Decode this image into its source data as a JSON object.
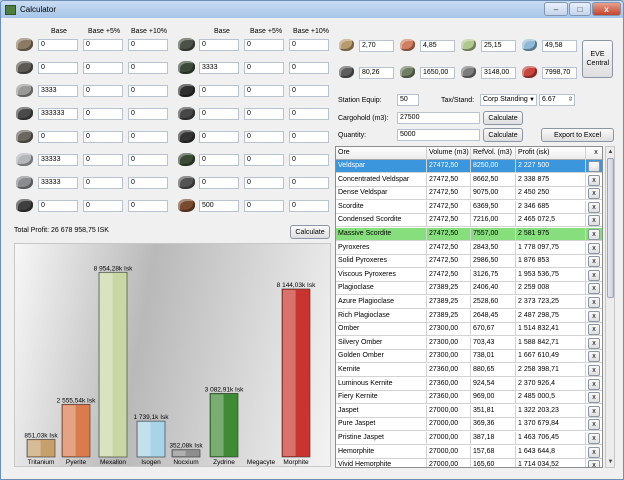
{
  "window": {
    "title": "Calculator",
    "minimize": "–",
    "maximize": "□",
    "close": "x"
  },
  "left_headers": {
    "col1": "Base",
    "col2": "Base +5%",
    "col3": "Base +10%"
  },
  "right_headers": {
    "col1": "Base",
    "col2": "Base +5%",
    "col3": "Base +10%"
  },
  "left_rows": [
    {
      "ore": "veldspar-ore-icon",
      "color": "#8c7a64",
      "v": [
        "0",
        "0",
        "0"
      ]
    },
    {
      "ore": "scordite-ore-icon",
      "color": "#5d5a56",
      "v": [
        "0",
        "0",
        "0"
      ]
    },
    {
      "ore": "pyroxeres-ore-icon",
      "color": "#9a9a98",
      "v": [
        "3333",
        "0",
        "0"
      ]
    },
    {
      "ore": "plagioclase-ore-icon",
      "color": "#4a4a4a",
      "v": [
        "333333",
        "0",
        "0"
      ]
    },
    {
      "ore": "omber-ore-icon",
      "color": "#6b665e",
      "v": [
        "0",
        "0",
        "0"
      ]
    },
    {
      "ore": "kernite-ore-icon",
      "color": "#b4b6ba",
      "v": [
        "33333",
        "0",
        "0"
      ]
    },
    {
      "ore": "jaspet-ore-icon",
      "color": "#8a8c8f",
      "v": [
        "33333",
        "0",
        "0"
      ]
    },
    {
      "ore": "hemorphite-ore-icon",
      "color": "#3f3f3f",
      "v": [
        "0",
        "0",
        "0"
      ]
    }
  ],
  "right_rows": [
    {
      "ore": "hedbergite-ore-icon",
      "color": "#4c5248",
      "v": [
        "0",
        "0",
        "0"
      ]
    },
    {
      "ore": "gneiss-ore-icon",
      "color": "#3d4a3a",
      "v": [
        "3333",
        "0",
        "0"
      ]
    },
    {
      "ore": "dark-ochre-ore-icon",
      "color": "#2f2f2f",
      "v": [
        "0",
        "0",
        "0"
      ]
    },
    {
      "ore": "crokite-ore-icon",
      "color": "#474747",
      "v": [
        "0",
        "0",
        "0"
      ]
    },
    {
      "ore": "spodumain-ore-icon",
      "color": "#343434",
      "v": [
        "0",
        "0",
        "0"
      ]
    },
    {
      "ore": "bistot-ore-icon",
      "color": "#3b4a35",
      "v": [
        "0",
        "0",
        "0"
      ]
    },
    {
      "ore": "arkonor-ore-icon",
      "color": "#535353",
      "v": [
        "0",
        "0",
        "0"
      ]
    },
    {
      "ore": "mercoxit-ore-icon",
      "color": "#7a4a2e",
      "v": [
        "500",
        "0",
        "0"
      ]
    }
  ],
  "total_profit": "Total Profit: 26 678 958,75 ISK",
  "calculate_label": "Calculate",
  "minerals": [
    {
      "icon": "tritanium-icon",
      "color": "#b89a6c",
      "value": "2,70"
    },
    {
      "icon": "pyerite-icon",
      "color": "#d08060",
      "value": "4,85"
    },
    {
      "icon": "mexallon-icon",
      "color": "#b0c78e",
      "value": "25,15"
    },
    {
      "icon": "isogen-icon",
      "color": "#8fbad5",
      "value": "49,58"
    },
    {
      "icon": "nocxium-icon",
      "color": "#5d5d5d",
      "value": "80,26"
    },
    {
      "icon": "zydrine-icon",
      "color": "#6f7e63",
      "value": "1650,00"
    },
    {
      "icon": "megacyte-icon",
      "color": "#7d7d7d",
      "value": "3148,00"
    },
    {
      "icon": "morphite-icon",
      "color": "#c8463c",
      "value": "7998,70"
    }
  ],
  "eve_central_label": "EVE Central",
  "station_equip_label": "Station Equip:",
  "station_equip_value": "50",
  "tax_stand_label": "Tax/Stand:",
  "corp_standing": "Corp Standing",
  "standing_value": "6.67",
  "cargohold_label": "Cargohold (m3):",
  "cargohold_value": "27500",
  "quantity_label": "Quantity:",
  "quantity_value": "5000",
  "calculate2_label": "Calculate",
  "calculate3_label": "Calculate",
  "export_label": "Export to Excel",
  "grid": {
    "headers": [
      "Ore",
      "Volume (m3)",
      "RefVol. (m3)",
      "Profit (isk)",
      "x"
    ],
    "rows": [
      {
        "ore": "Veldspar",
        "vol": "27472,50",
        "ref": "8250,00",
        "profit": "2 227 500",
        "state": "selected"
      },
      {
        "ore": "Concentrated Veldspar",
        "vol": "27472,50",
        "ref": "8662,50",
        "profit": "2 338 875",
        "state": ""
      },
      {
        "ore": "Dense Veldspar",
        "vol": "27472,50",
        "ref": "9075,00",
        "profit": "2 450 250",
        "state": ""
      },
      {
        "ore": "Scordite",
        "vol": "27472,50",
        "ref": "6369,50",
        "profit": "2 346 685",
        "state": ""
      },
      {
        "ore": "Condensed Scordite",
        "vol": "27472,50",
        "ref": "7216,00",
        "profit": "2 465 072,5",
        "state": ""
      },
      {
        "ore": "Massive Scordite",
        "vol": "27472,50",
        "ref": "7557,00",
        "profit": "2 581 975",
        "state": "best"
      },
      {
        "ore": "Pyroxeres",
        "vol": "27472,50",
        "ref": "2843,50",
        "profit": "1 778 097,75",
        "state": ""
      },
      {
        "ore": "Solid Pyroxeres",
        "vol": "27472,50",
        "ref": "2986,50",
        "profit": "1 876 853",
        "state": ""
      },
      {
        "ore": "Viscous Pyroxeres",
        "vol": "27472,50",
        "ref": "3126,75",
        "profit": "1 953 536,75",
        "state": ""
      },
      {
        "ore": "Plagioclase",
        "vol": "27389,25",
        "ref": "2406,40",
        "profit": "2 259 008",
        "state": ""
      },
      {
        "ore": "Azure Plagioclase",
        "vol": "27389,25",
        "ref": "2528,60",
        "profit": "2 373 723,25",
        "state": ""
      },
      {
        "ore": "Rich Plagioclase",
        "vol": "27389,25",
        "ref": "2648,45",
        "profit": "2 487 298,75",
        "state": ""
      },
      {
        "ore": "Omber",
        "vol": "27300,00",
        "ref": "670,67",
        "profit": "1 514 832,41",
        "state": ""
      },
      {
        "ore": "Silvery Omber",
        "vol": "27300,00",
        "ref": "703,43",
        "profit": "1 588 842,71",
        "state": ""
      },
      {
        "ore": "Golden Omber",
        "vol": "27300,00",
        "ref": "738,01",
        "profit": "1 667 610,49",
        "state": ""
      },
      {
        "ore": "Kernite",
        "vol": "27360,00",
        "ref": "880,65",
        "profit": "2 258 398,71",
        "state": ""
      },
      {
        "ore": "Luminous Kernite",
        "vol": "27360,00",
        "ref": "924,54",
        "profit": "2 370 926,4",
        "state": ""
      },
      {
        "ore": "Fiery Kernite",
        "vol": "27360,00",
        "ref": "969,00",
        "profit": "2 485 000,5",
        "state": ""
      },
      {
        "ore": "Jaspet",
        "vol": "27000,00",
        "ref": "351,81",
        "profit": "1 322 203,23",
        "state": ""
      },
      {
        "ore": "Pure Jaspet",
        "vol": "27000,00",
        "ref": "369,36",
        "profit": "1 370 679,84",
        "state": ""
      },
      {
        "ore": "Pristine Jaspet",
        "vol": "27000,00",
        "ref": "387,18",
        "profit": "1 463 706,45",
        "state": ""
      },
      {
        "ore": "Hemorphite",
        "vol": "27000,00",
        "ref": "157,68",
        "profit": "1 643 644,8",
        "state": ""
      },
      {
        "ore": "Vivid Hemorphite",
        "vol": "27000,00",
        "ref": "165,60",
        "profit": "1 714 034,52",
        "state": ""
      }
    ]
  },
  "chart_data": {
    "type": "bar",
    "title": "",
    "xlabel": "",
    "ylabel": "",
    "categories": [
      "Tritanium",
      "Pyerite",
      "Mexallon",
      "Isogen",
      "Nocxium",
      "Zydrine",
      "Megacyte",
      "Morphite"
    ],
    "values": [
      851.03,
      2555.54,
      8954.28,
      1739.1,
      352.08,
      3082.91,
      0,
      8144.03
    ],
    "value_labels": [
      "851,03k Isk",
      "2 555,54k Isk",
      "8 954,28k Isk",
      "1 739,1k Isk",
      "352,08k Isk",
      "3 082,91k Isk",
      "",
      "8 144,03k Isk"
    ],
    "colors": [
      "#c6a06c",
      "#d97b4d",
      "#c9d7a4",
      "#a9d3e6",
      "#8e8e8e",
      "#3f8a35",
      "#777777",
      "#c9352e"
    ],
    "ylim": [
      0,
      9500
    ],
    "grid": false,
    "legend": "none"
  }
}
